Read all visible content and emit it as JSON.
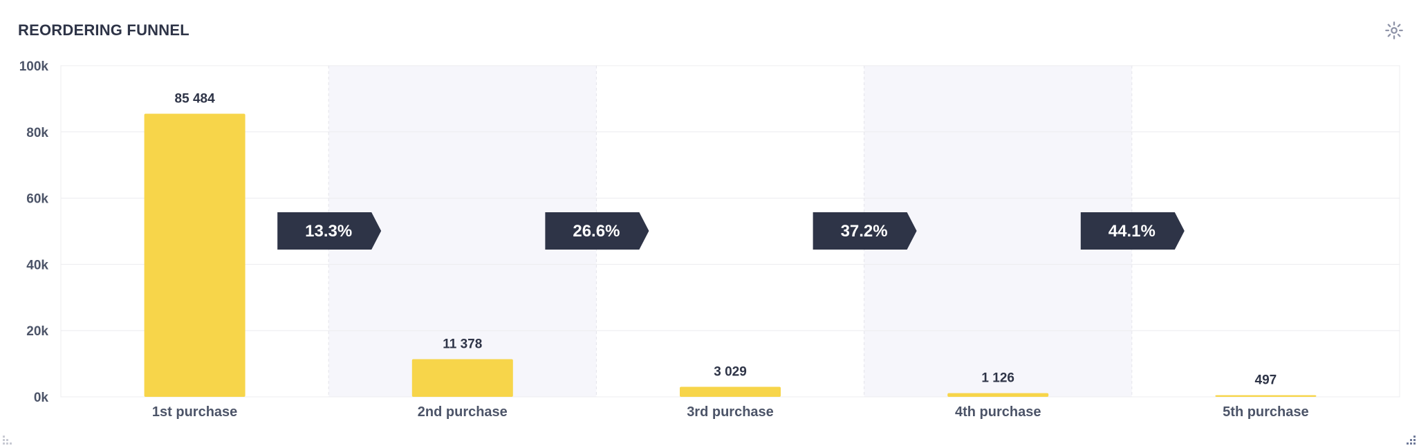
{
  "card": {
    "title": "REORDERING FUNNEL",
    "settings_icon": "gear-icon"
  },
  "colors": {
    "bar": "#F7D54A",
    "badge": "#2E3447",
    "badge_text": "#FFFFFF",
    "band": "#F6F6FB",
    "grid": "#ECECEF",
    "axis_text": "#4C5468",
    "label_text": "#2E3447",
    "icon": "#8F94A8"
  },
  "chart_data": {
    "type": "bar",
    "title": "REORDERING FUNNEL",
    "categories": [
      "1st purchase",
      "2nd purchase",
      "3rd purchase",
      "4th purchase",
      "5th purchase"
    ],
    "values": [
      85484,
      11378,
      3029,
      1126,
      497
    ],
    "value_labels": [
      "85 484",
      "11 378",
      "3 029",
      "1 126",
      "497"
    ],
    "conversion_rates": [
      "13.3%",
      "26.6%",
      "37.2%",
      "44.1%"
    ],
    "ylim": [
      0,
      100000
    ],
    "yticks": [
      0,
      20000,
      40000,
      60000,
      80000,
      100000
    ],
    "ytick_labels": [
      "0k",
      "20k",
      "40k",
      "60k",
      "80k",
      "100k"
    ],
    "xlabel": "",
    "ylabel": "",
    "grid": true,
    "alternate_bands": true,
    "legend": "none"
  }
}
